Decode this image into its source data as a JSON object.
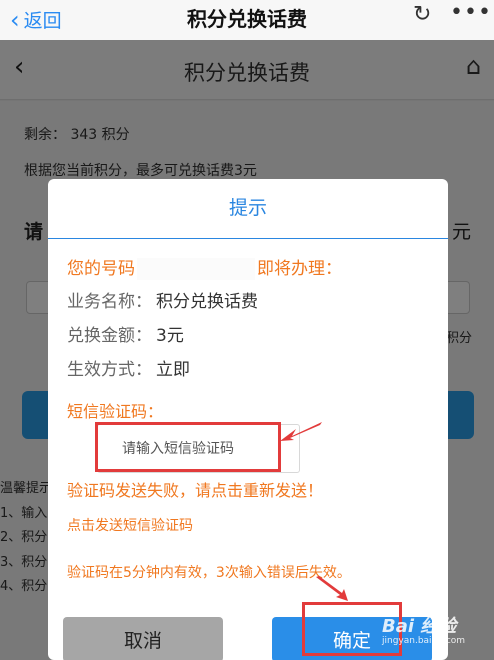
{
  "appnav": {
    "back_label": "返回",
    "title": "积分兑换话费"
  },
  "page": {
    "header_title": "积分兑换话费",
    "remaining": "剩余：  343 积分",
    "max_info": "根据您当前积分，最多可兑换话费3元",
    "partial_left": "请",
    "partial_right": "元",
    "partial_points": "积分",
    "tip_lines": [
      "温馨提示",
      "1、输入",
      "2、积分",
      "3、积分",
      "4、积分"
    ]
  },
  "dialog": {
    "title": "提示",
    "phone_prefix": "您的号码",
    "phone_suffix": "即将办理：",
    "rows": [
      {
        "label": "业务名称：",
        "value": "积分兑换话费"
      },
      {
        "label": "兑换金额：",
        "value": "3元"
      },
      {
        "label": "生效方式：",
        "value": "立即"
      }
    ],
    "sms_label": "短信验证码：",
    "sms_placeholder": "请输入短信验证码",
    "fail_msg": "验证码发送失败，请点击重新发送！",
    "send_link": "点击发送短信验证码",
    "validity_note": "验证码在5分钟内有效，3次输入错误后失效。",
    "cancel_label": "取消",
    "ok_label": "确定"
  },
  "watermark": {
    "brand": "Bai 经验",
    "url": "jingyan.baidu.com"
  },
  "colors": {
    "accent_blue": "#2a86e0",
    "notice_orange": "#f07820",
    "highlight_red": "#e23b3b"
  },
  "icons": [
    "back-chevron-icon",
    "refresh-icon",
    "more-icon",
    "home-icon",
    "arrow-annotation-icon"
  ]
}
